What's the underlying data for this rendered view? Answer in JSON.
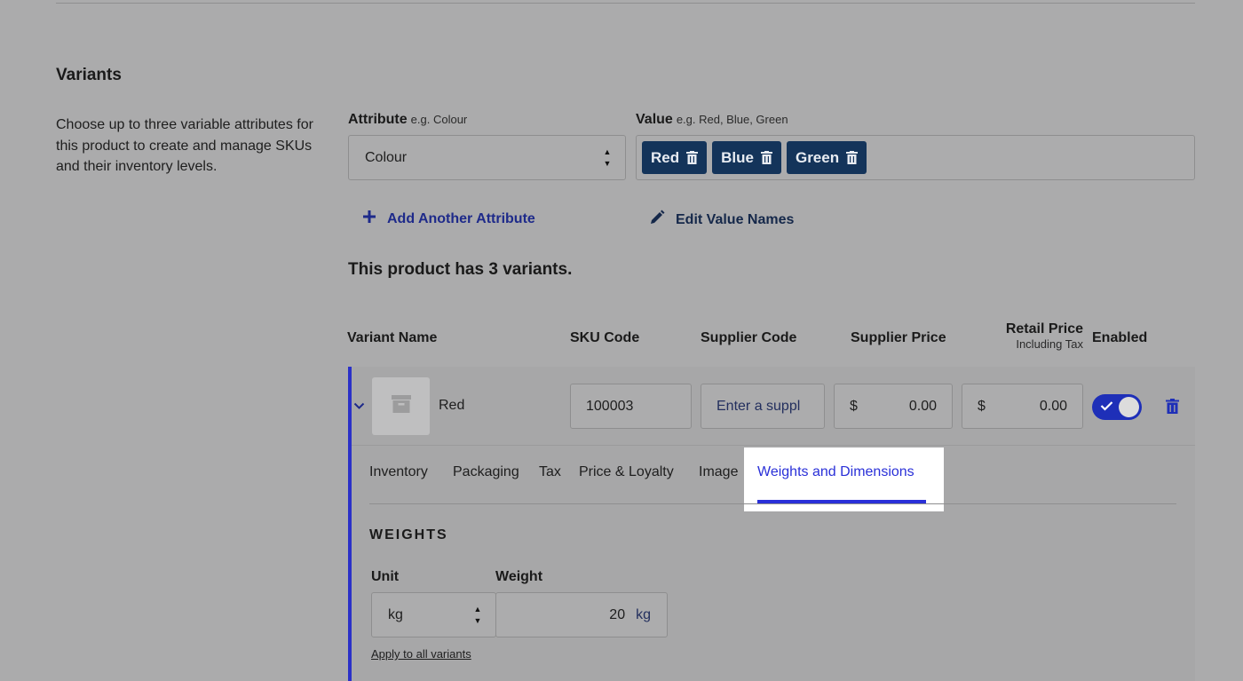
{
  "section": {
    "title": "Variants",
    "description": "Choose up to three variable attributes for this product to create and manage SKUs and their inventory levels."
  },
  "attribute": {
    "label": "Attribute",
    "hint": "e.g. Colour",
    "selected": "Colour"
  },
  "value": {
    "label": "Value",
    "hint": "e.g. Red, Blue, Green",
    "chips": [
      "Red",
      "Blue",
      "Green"
    ]
  },
  "actions": {
    "add_attribute": "Add Another Attribute",
    "edit_value_names": "Edit Value Names"
  },
  "variant_count_text": "This product has 3 variants.",
  "table": {
    "headers": {
      "variant_name": "Variant Name",
      "sku_code": "SKU Code",
      "supplier_code": "Supplier Code",
      "supplier_price": "Supplier Price",
      "retail_price": "Retail Price",
      "retail_price_sub": "Including Tax",
      "enabled": "Enabled"
    },
    "row": {
      "name": "Red",
      "sku": "100003",
      "supplier_code_placeholder": "Enter a suppl",
      "currency": "$",
      "supplier_price": "0.00",
      "retail_price": "0.00",
      "enabled": true
    }
  },
  "tabs": [
    "Inventory",
    "Packaging",
    "Tax",
    "Price & Loyalty",
    "Image",
    "Weights and Dimensions"
  ],
  "active_tab": "Weights and Dimensions",
  "weights": {
    "title": "WEIGHTS",
    "unit_label": "Unit",
    "weight_label": "Weight",
    "unit_value": "kg",
    "weight_value": "20",
    "weight_suffix": "kg",
    "apply_all": "Apply to all variants"
  },
  "colors": {
    "accent": "#2a30d8",
    "chip": "#14345a",
    "background": "#ababac"
  },
  "icons": [
    "plus-icon",
    "pencil-icon",
    "trash-icon",
    "chevron-down-icon",
    "box-icon",
    "check-icon",
    "spinner-icon"
  ]
}
